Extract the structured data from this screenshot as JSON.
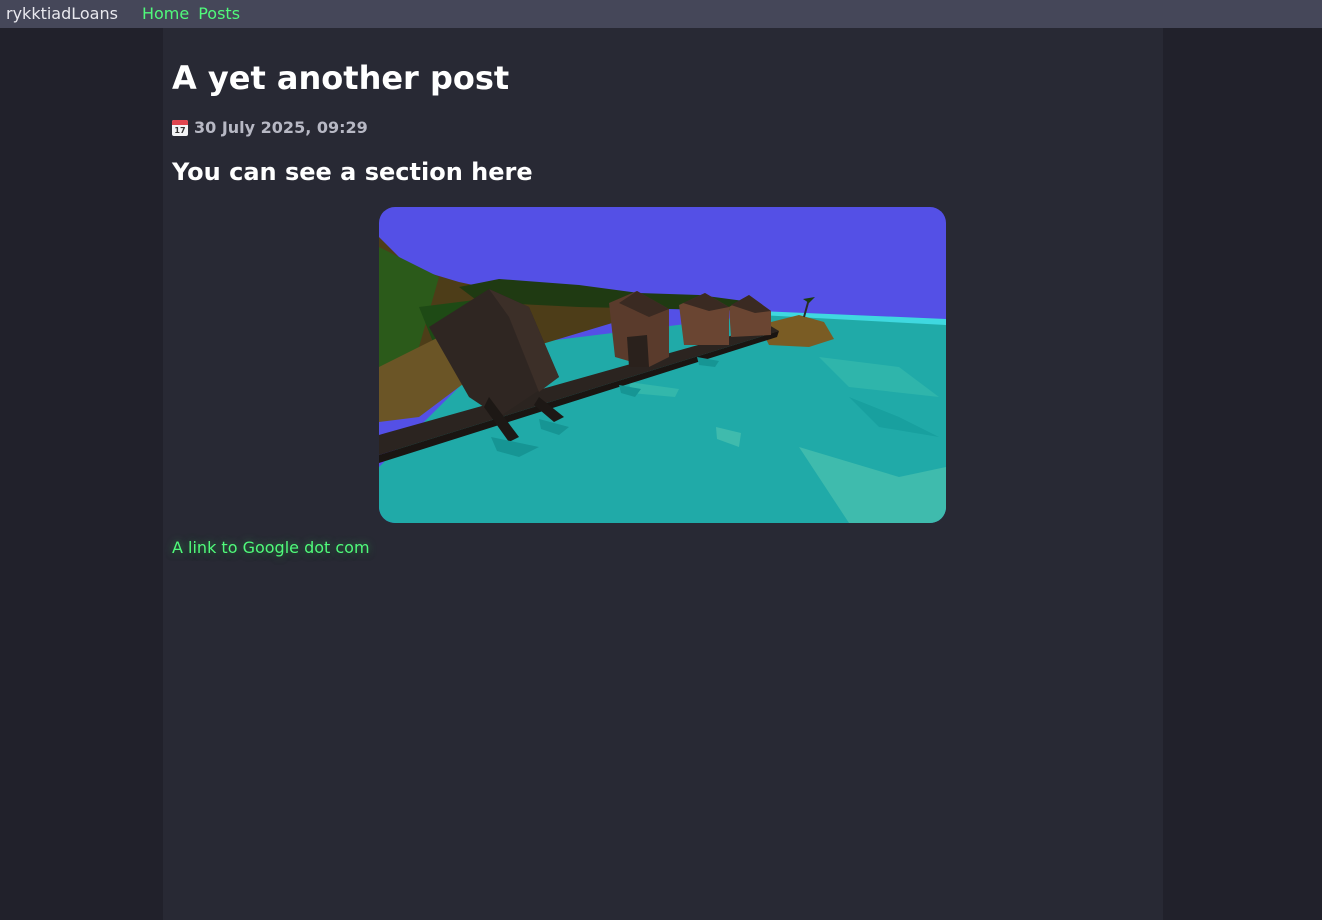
{
  "header": {
    "brand": "rykktiadLoans",
    "nav": [
      {
        "label": "Home"
      },
      {
        "label": "Posts"
      }
    ]
  },
  "post": {
    "title": "A yet another post",
    "date": "30 July 2025, 09:29",
    "date_icon": "calendar-icon",
    "calendar_icon_day": "17",
    "section_heading": "You can see a section here",
    "image": {
      "description_icon": "post-image",
      "sky_color": "#5450e6",
      "water_color": "#20aaa8"
    },
    "link_text": "A link to Google dot com"
  },
  "colors": {
    "accent": "#50fa7b",
    "page_bg": "#21212b",
    "content_bg": "#282934",
    "topbar_bg": "#454759"
  }
}
